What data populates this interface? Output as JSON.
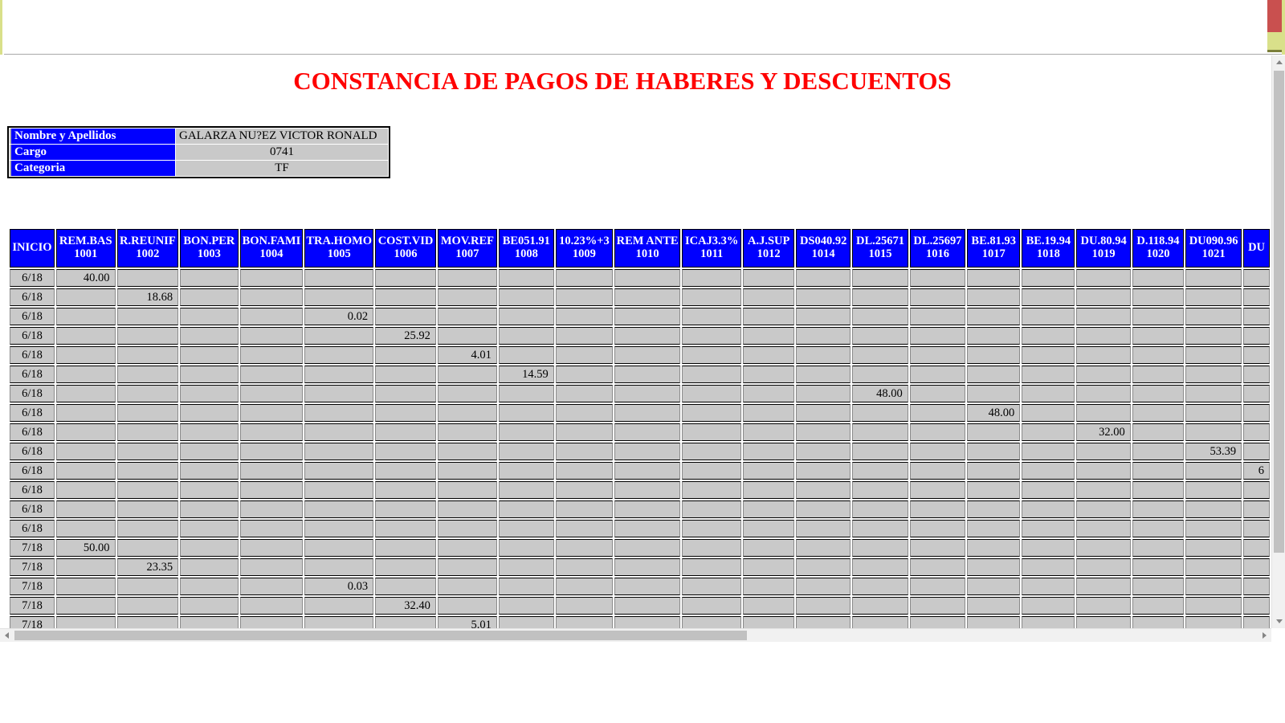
{
  "document": {
    "title": "CONSTANCIA DE PAGOS DE HABERES Y DESCUENTOS",
    "title_color": "#ff0000",
    "header_bg_color": "#0000ff",
    "cell_bg_color": "#c9c9c9"
  },
  "info": {
    "rows": [
      {
        "label": "Nombre y Apellidos",
        "value": "GALARZA NU?EZ VICTOR RONALD",
        "align": "left"
      },
      {
        "label": "Cargo",
        "value": "0741",
        "align": "center"
      },
      {
        "label": "Categoria",
        "value": "TF",
        "align": "center"
      }
    ]
  },
  "table": {
    "columns": [
      {
        "code": "INICIO",
        "num": ""
      },
      {
        "code": "REM.BAS",
        "num": "1001"
      },
      {
        "code": "R.REUNIF",
        "num": "1002"
      },
      {
        "code": "BON.PER",
        "num": "1003"
      },
      {
        "code": "BON.FAMI",
        "num": "1004"
      },
      {
        "code": "TRA.HOMO",
        "num": "1005"
      },
      {
        "code": "COST.VID",
        "num": "1006"
      },
      {
        "code": "MOV.REF",
        "num": "1007"
      },
      {
        "code": "BE051.91",
        "num": "1008"
      },
      {
        "code": "10.23%+3",
        "num": "1009"
      },
      {
        "code": "REM ANTE",
        "num": "1010"
      },
      {
        "code": "ICAJ3.3%",
        "num": "1011"
      },
      {
        "code": "A.J.SUP",
        "num": "1012"
      },
      {
        "code": "DS040.92",
        "num": "1014"
      },
      {
        "code": "DL.25671",
        "num": "1015"
      },
      {
        "code": "DL.25697",
        "num": "1016"
      },
      {
        "code": "BE.81.93",
        "num": "1017"
      },
      {
        "code": "BE.19.94",
        "num": "1018"
      },
      {
        "code": "DU.80.94",
        "num": "1019"
      },
      {
        "code": "D.118.94",
        "num": "1020"
      },
      {
        "code": "DU090.96",
        "num": "1021"
      },
      {
        "code": "DU",
        "num": ""
      }
    ],
    "rows": [
      [
        "6/18",
        "40.00",
        "",
        "",
        "",
        "",
        "",
        "",
        "",
        "",
        "",
        "",
        "",
        "",
        "",
        "",
        "",
        "",
        "",
        "",
        "",
        ""
      ],
      [
        "6/18",
        "",
        "18.68",
        "",
        "",
        "",
        "",
        "",
        "",
        "",
        "",
        "",
        "",
        "",
        "",
        "",
        "",
        "",
        "",
        "",
        "",
        ""
      ],
      [
        "6/18",
        "",
        "",
        "",
        "",
        "0.02",
        "",
        "",
        "",
        "",
        "",
        "",
        "",
        "",
        "",
        "",
        "",
        "",
        "",
        "",
        "",
        ""
      ],
      [
        "6/18",
        "",
        "",
        "",
        "",
        "",
        "25.92",
        "",
        "",
        "",
        "",
        "",
        "",
        "",
        "",
        "",
        "",
        "",
        "",
        "",
        "",
        ""
      ],
      [
        "6/18",
        "",
        "",
        "",
        "",
        "",
        "",
        "4.01",
        "",
        "",
        "",
        "",
        "",
        "",
        "",
        "",
        "",
        "",
        "",
        "",
        "",
        ""
      ],
      [
        "6/18",
        "",
        "",
        "",
        "",
        "",
        "",
        "",
        "14.59",
        "",
        "",
        "",
        "",
        "",
        "",
        "",
        "",
        "",
        "",
        "",
        "",
        ""
      ],
      [
        "6/18",
        "",
        "",
        "",
        "",
        "",
        "",
        "",
        "",
        "",
        "",
        "",
        "",
        "",
        "48.00",
        "",
        "",
        "",
        "",
        "",
        "",
        ""
      ],
      [
        "6/18",
        "",
        "",
        "",
        "",
        "",
        "",
        "",
        "",
        "",
        "",
        "",
        "",
        "",
        "",
        "",
        "48.00",
        "",
        "",
        "",
        "",
        ""
      ],
      [
        "6/18",
        "",
        "",
        "",
        "",
        "",
        "",
        "",
        "",
        "",
        "",
        "",
        "",
        "",
        "",
        "",
        "",
        "",
        "32.00",
        "",
        "",
        ""
      ],
      [
        "6/18",
        "",
        "",
        "",
        "",
        "",
        "",
        "",
        "",
        "",
        "",
        "",
        "",
        "",
        "",
        "",
        "",
        "",
        "",
        "",
        "53.39",
        ""
      ],
      [
        "6/18",
        "",
        "",
        "",
        "",
        "",
        "",
        "",
        "",
        "",
        "",
        "",
        "",
        "",
        "",
        "",
        "",
        "",
        "",
        "",
        "",
        "6"
      ],
      [
        "6/18",
        "",
        "",
        "",
        "",
        "",
        "",
        "",
        "",
        "",
        "",
        "",
        "",
        "",
        "",
        "",
        "",
        "",
        "",
        "",
        "",
        ""
      ],
      [
        "6/18",
        "",
        "",
        "",
        "",
        "",
        "",
        "",
        "",
        "",
        "",
        "",
        "",
        "",
        "",
        "",
        "",
        "",
        "",
        "",
        "",
        ""
      ],
      [
        "6/18",
        "",
        "",
        "",
        "",
        "",
        "",
        "",
        "",
        "",
        "",
        "",
        "",
        "",
        "",
        "",
        "",
        "",
        "",
        "",
        "",
        ""
      ],
      [
        "7/18",
        "50.00",
        "",
        "",
        "",
        "",
        "",
        "",
        "",
        "",
        "",
        "",
        "",
        "",
        "",
        "",
        "",
        "",
        "",
        "",
        "",
        ""
      ],
      [
        "7/18",
        "",
        "23.35",
        "",
        "",
        "",
        "",
        "",
        "",
        "",
        "",
        "",
        "",
        "",
        "",
        "",
        "",
        "",
        "",
        "",
        "",
        ""
      ],
      [
        "7/18",
        "",
        "",
        "",
        "",
        "0.03",
        "",
        "",
        "",
        "",
        "",
        "",
        "",
        "",
        "",
        "",
        "",
        "",
        "",
        "",
        "",
        ""
      ],
      [
        "7/18",
        "",
        "",
        "",
        "",
        "",
        "32.40",
        "",
        "",
        "",
        "",
        "",
        "",
        "",
        "",
        "",
        "",
        "",
        "",
        "",
        "",
        ""
      ],
      [
        "7/18",
        "",
        "",
        "",
        "",
        "",
        "",
        "5.01",
        "",
        "",
        "",
        "",
        "",
        "",
        "",
        "",
        "",
        "",
        "",
        "",
        "",
        ""
      ]
    ]
  },
  "scrollbars": {
    "vertical_label": "vertical-scrollbar",
    "horizontal_label": "horizontal-scrollbar"
  }
}
